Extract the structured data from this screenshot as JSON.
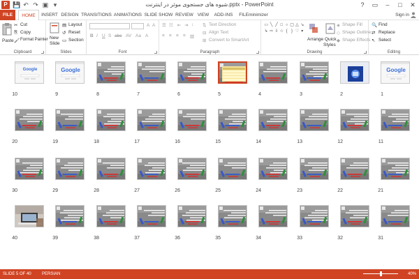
{
  "window": {
    "title": "شیوه های جستجوی موثر در اینترنت.pptx - PowerPoint",
    "app_logo": "P"
  },
  "quick_access": {
    "items": [
      "save-icon",
      "undo-icon",
      "redo-icon",
      "start-icon",
      "customize-icon"
    ]
  },
  "window_controls": [
    "?",
    "▭",
    "–",
    "□",
    "✕"
  ],
  "ribbon_tabs": [
    {
      "label": "FILE"
    },
    {
      "label": "HOME"
    },
    {
      "label": "INSERT"
    },
    {
      "label": "DESIGN"
    },
    {
      "label": "TRANSITIONS"
    },
    {
      "label": "ANIMATIONS"
    },
    {
      "label": "SLIDE SHOW"
    },
    {
      "label": "REVIEW"
    },
    {
      "label": "VIEW"
    },
    {
      "label": "ADD-INS"
    },
    {
      "label": "FILEminimizer"
    }
  ],
  "active_tab": "HOME",
  "sign_in": "Sign in",
  "ribbon": {
    "clipboard": {
      "label": "Clipboard",
      "paste": "Paste",
      "cut": "Cut",
      "copy": "Copy",
      "format_painter": "Format Painter"
    },
    "slides": {
      "label": "Slides",
      "new_slide": "New",
      "new_slide_2": "Slide",
      "layout": "Layout",
      "reset": "Reset",
      "section": "Section"
    },
    "font": {
      "label": "Font"
    },
    "paragraph": {
      "label": "Paragraph",
      "text_direction": "Text Direction",
      "align_text": "Align Text",
      "convert_smartart": "Convert to SmartArt"
    },
    "drawing": {
      "label": "Drawing",
      "arrange": "Arrange",
      "quick_styles": "Quick",
      "quick_styles_2": "Styles",
      "shape_fill": "Shape Fill",
      "shape_outline": "Shape Outline",
      "shape_effects": "Shape Effects"
    },
    "editing": {
      "label": "Editing",
      "find": "Find",
      "replace": "Replace",
      "select": "Select"
    }
  },
  "slides": [
    {
      "n": "1",
      "kind": "google"
    },
    {
      "n": "2",
      "kind": "blue"
    },
    {
      "n": "3",
      "kind": "photo"
    },
    {
      "n": "4",
      "kind": "photo"
    },
    {
      "n": "5",
      "kind": "table",
      "selected": true
    },
    {
      "n": "6",
      "kind": "photo"
    },
    {
      "n": "7",
      "kind": "photo"
    },
    {
      "n": "8",
      "kind": "photo"
    },
    {
      "n": "9",
      "kind": "google"
    },
    {
      "n": "10",
      "kind": "google-small"
    },
    {
      "n": "11",
      "kind": "photo"
    },
    {
      "n": "12",
      "kind": "photo"
    },
    {
      "n": "13",
      "kind": "photo"
    },
    {
      "n": "14",
      "kind": "photo"
    },
    {
      "n": "15",
      "kind": "photo"
    },
    {
      "n": "16",
      "kind": "photo"
    },
    {
      "n": "17",
      "kind": "photo"
    },
    {
      "n": "18",
      "kind": "photo"
    },
    {
      "n": "19",
      "kind": "photo"
    },
    {
      "n": "20",
      "kind": "photo"
    },
    {
      "n": "21",
      "kind": "photo"
    },
    {
      "n": "22",
      "kind": "photo"
    },
    {
      "n": "23",
      "kind": "photo"
    },
    {
      "n": "24",
      "kind": "photo"
    },
    {
      "n": "25",
      "kind": "photo"
    },
    {
      "n": "26",
      "kind": "photo"
    },
    {
      "n": "27",
      "kind": "photo"
    },
    {
      "n": "28",
      "kind": "photo"
    },
    {
      "n": "29",
      "kind": "photo"
    },
    {
      "n": "30",
      "kind": "photo"
    },
    {
      "n": "31",
      "kind": "photo"
    },
    {
      "n": "32",
      "kind": "photo"
    },
    {
      "n": "33",
      "kind": "photo"
    },
    {
      "n": "34",
      "kind": "photo"
    },
    {
      "n": "35",
      "kind": "photo"
    },
    {
      "n": "36",
      "kind": "photo"
    },
    {
      "n": "37",
      "kind": "photo"
    },
    {
      "n": "38",
      "kind": "photo"
    },
    {
      "n": "39",
      "kind": "photo"
    },
    {
      "n": "40",
      "kind": "laptop"
    }
  ],
  "google_logo_text": "Google",
  "status": {
    "slide_indicator": "SLIDE 5 OF 40",
    "language": "PERSIAN",
    "zoom": "40%",
    "zoom_level": 0.4
  },
  "colors": {
    "accent": "#d04423",
    "status_bar": "#d04423"
  }
}
